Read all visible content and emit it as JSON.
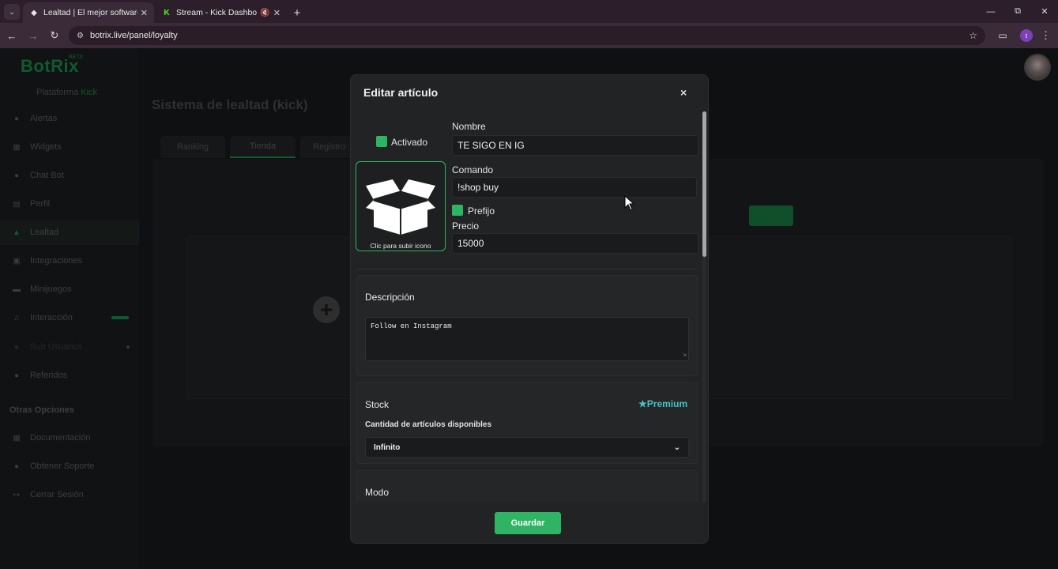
{
  "browser": {
    "tabs": [
      {
        "title": "Lealtad | El mejor software para",
        "favicon": "botrix-icon",
        "active": true
      },
      {
        "title": "Stream - Kick Dashboard",
        "favicon": "kick-icon",
        "active": false,
        "muted": true
      }
    ],
    "url": "botrix.live/panel/loyalty",
    "profile_initial": "t"
  },
  "app": {
    "logo": "BotRix",
    "logo_badge": "BETA",
    "platform_label": "Plataforma",
    "platform_value": "Kick",
    "sidebar": {
      "items": [
        {
          "label": "Alertas",
          "icon": "bell-icon"
        },
        {
          "label": "Widgets",
          "icon": "widgets-icon"
        },
        {
          "label": "Chat Bot",
          "icon": "chat-icon"
        },
        {
          "label": "Perfil",
          "icon": "profile-icon"
        },
        {
          "label": "Lealtad",
          "icon": "trophy-icon",
          "active": true
        },
        {
          "label": "Integraciones",
          "icon": "integrations-icon"
        },
        {
          "label": "Minijuegos",
          "icon": "gamepad-icon"
        },
        {
          "label": "Interacción",
          "icon": "music-icon"
        },
        {
          "label": "Sub Usuarios",
          "icon": "users-icon"
        },
        {
          "label": "Referidos",
          "icon": "referrals-icon"
        }
      ],
      "other_heading": "Otras Opciones",
      "other_items": [
        {
          "label": "Documentación",
          "icon": "book-icon"
        },
        {
          "label": "Obtener Soporte",
          "icon": "support-icon"
        },
        {
          "label": "Cerrar Sesión",
          "icon": "logout-icon"
        }
      ]
    },
    "page_title": "Sistema de lealtad (kick)",
    "tabs": [
      {
        "label": "Ranking"
      },
      {
        "label": "Tienda",
        "selected": true
      },
      {
        "label": "Registro"
      }
    ]
  },
  "modal": {
    "title": "Editar artículo",
    "close": "×",
    "activated_label": "Activado",
    "icon_caption": "Clic para subir icono",
    "name_label": "Nombre",
    "name_value": "TE SIGO EN IG",
    "command_label": "Comando",
    "command_value": "!shop buy",
    "prefix_label": "Prefijo",
    "price_label": "Precio",
    "price_value": "15000",
    "description": {
      "title": "Descripción",
      "value": "Follow en Instagram"
    },
    "stock": {
      "title": "Stock",
      "premium": "Premium",
      "sub_label": "Cantidad de artículos disponibles",
      "selected": "Infinito"
    },
    "mode": {
      "title": "Modo"
    },
    "save_label": "Guardar"
  },
  "colors": {
    "accent_green": "#2fb463",
    "premium_teal": "#45c4c0",
    "modal_bg": "#222324"
  }
}
